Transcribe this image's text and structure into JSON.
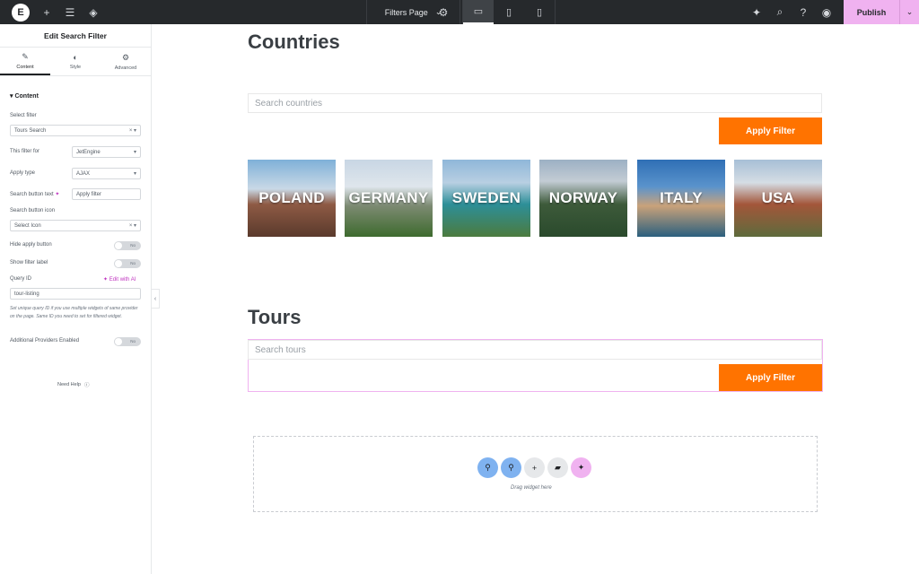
{
  "topbar": {
    "logo": "E",
    "page_selector": "Filters Page",
    "publish_label": "Publish",
    "accent_color": "#f0b2f0"
  },
  "panel": {
    "title": "Edit Search Filter",
    "tabs": [
      {
        "label": "Content",
        "icon": "pencil-icon"
      },
      {
        "label": "Style",
        "icon": "contrast-icon"
      },
      {
        "label": "Advanced",
        "icon": "gear-icon"
      }
    ],
    "section": "Content",
    "select_filter_label": "Select filter",
    "select_filter_value": "Tours Search",
    "filter_for_label": "This filter for",
    "filter_for_value": "JetEngine",
    "apply_type_label": "Apply type",
    "apply_type_value": "AJAX",
    "search_btn_text_label": "Search button text",
    "search_btn_text_value": "Apply filter",
    "search_btn_icon_label": "Search button icon",
    "search_btn_icon_value": "Select Icon",
    "hide_apply_label": "Hide apply button",
    "show_filter_label": "Show filter label",
    "query_id_label": "Query ID",
    "edit_with_ai": "Edit with AI",
    "query_id_value": "tour-listing",
    "query_hint": "Set unique query ID if you use multiple widgets of same provider on the page. Same ID you need to set for filtered widget.",
    "additional_providers_label": "Additional Providers Enabled",
    "toggle_off": "No",
    "need_help": "Need Help"
  },
  "canvas": {
    "countries_heading": "Countries",
    "countries_placeholder": "Search countries",
    "apply_label": "Apply Filter",
    "countries": [
      "POLAND",
      "GERMANY",
      "SWEDEN",
      "NORWAY",
      "ITALY",
      "USA"
    ],
    "tours_heading": "Tours",
    "tours_placeholder": "Search tours",
    "drag_hint": "Drag widget here",
    "button_color": "#ff7300"
  }
}
